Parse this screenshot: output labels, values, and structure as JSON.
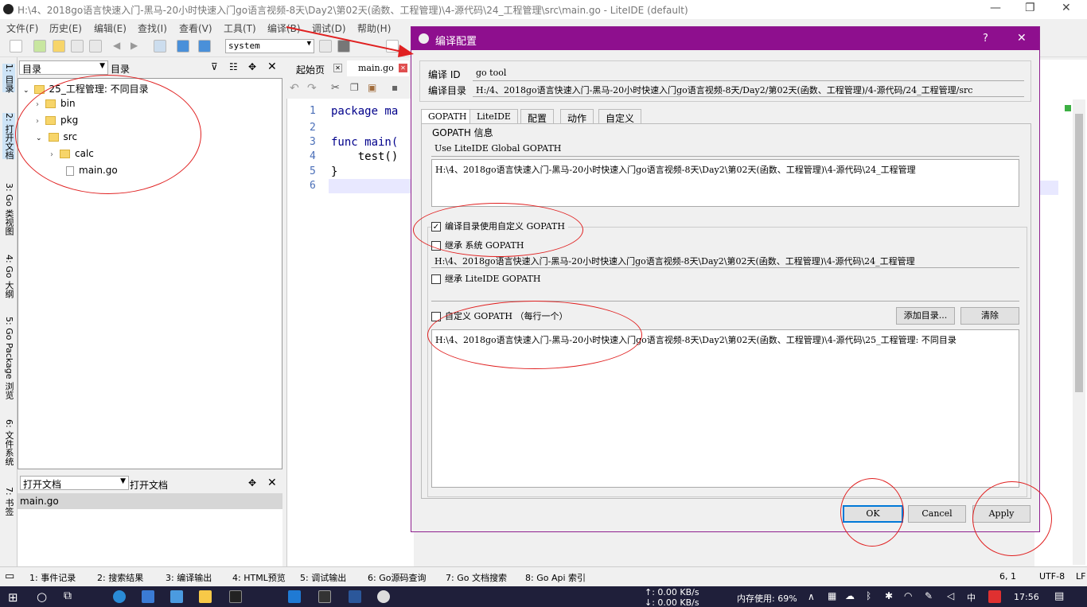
{
  "window": {
    "title": "H:\\4、2018go语言快速入门-黑马-20小时快速入门go语言视频-8天\\Day2\\第02天(函数、工程管理)\\4-源代码\\24_工程管理\\src\\main.go - LiteIDE (default)",
    "minimize": "—",
    "restore": "❐",
    "close": "✕"
  },
  "menu": [
    "文件(F)",
    "历史(E)",
    "编辑(E)",
    "查找(I)",
    "查看(V)",
    "工具(T)",
    "编译(B)",
    "调试(D)",
    "帮助(H)"
  ],
  "toolbar": {
    "env_select": "system"
  },
  "sidetabs": [
    "1: 目录",
    "2: 打开文档",
    "3: Go 类视图",
    "4: Go 大纲",
    "5: Go Package 浏览",
    "6: 文件系统",
    "7: 书签"
  ],
  "dirpanel": {
    "combo": "目录",
    "label": "目录",
    "tree": [
      {
        "label": "25_工程管理: 不同目录",
        "type": "folder"
      },
      {
        "label": "bin",
        "type": "folder"
      },
      {
        "label": "pkg",
        "type": "folder"
      },
      {
        "label": "src",
        "type": "folder"
      },
      {
        "label": "calc",
        "type": "folder"
      },
      {
        "label": "main.go",
        "type": "file"
      }
    ]
  },
  "openpanel": {
    "combo": "打开文档",
    "label": "打开文档",
    "item": "main.go"
  },
  "editor": {
    "tabs": [
      "起始页",
      "main.go"
    ],
    "lines": [
      "1",
      "2",
      "3",
      "4",
      "5",
      "6"
    ],
    "code": [
      "package ma",
      "",
      "func main(",
      "    test()",
      "}",
      ""
    ]
  },
  "statusbar": {
    "tabs": [
      "1: 事件记录",
      "2: 搜索结果",
      "3: 编译输出",
      "4: HTML预览",
      "5: 调试输出",
      "6: Go源码查询",
      "7: Go 文档搜索",
      "8: Go Api 索引"
    ],
    "position": "6,  1",
    "encoding": "UTF-8",
    "eol": "LF"
  },
  "taskbar": {
    "net_up": "↑: 0.00 KB/s",
    "net_down": "↓: 0.00 KB/s",
    "memory": "内存使用: 69%",
    "ime": "中",
    "time": "17:56"
  },
  "dialog": {
    "title": "编译配置",
    "help": "?",
    "close": "✕",
    "id_label": "编译 ID",
    "id_value": "go tool",
    "dir_label": "编译目录",
    "dir_value": "H:/4、2018go语言快速入门-黑马-20小时快速入门go语言视频-8天/Day2/第02天(函数、工程管理)/4-源代码/24_工程管理/src",
    "tabs": [
      "GOPATH",
      "LiteIDE",
      "配置",
      "动作",
      "自定义"
    ],
    "gopath_info_label": "GOPATH 信息",
    "gopath_info_header": "Use LiteIDE Global GOPATH",
    "gopath_info_value": "H:\\4、2018go语言快速入门-黑马-20小时快速入门go语言视频-8天\\Day2\\第02天(函数、工程管理)\\4-源代码\\24_工程管理",
    "use_custom_label": "编译目录使用自定义 GOPATH",
    "use_custom_checked": true,
    "inherit_system_label": "继承 系统 GOPATH",
    "inherit_system_checked": false,
    "inherit_system_value": "H:\\4、2018go语言快速入门-黑马-20小时快速入门go语言视频-8天\\Day2\\第02天(函数、工程管理)\\4-源代码\\24_工程管理",
    "inherit_liteide_label": "继承 LiteIDE GOPATH",
    "inherit_liteide_checked": false,
    "custom_label": "自定义 GOPATH （每行一个）",
    "custom_checked": false,
    "add_dir": "添加目录...",
    "clear": "清除",
    "custom_value": "H:\\4、2018go语言快速入门-黑马-20小时快速入门go语言视频-8天\\Day2\\第02天(函数、工程管理)\\4-源代码\\25_工程管理: 不同目录",
    "ok": "OK",
    "cancel": "Cancel",
    "apply": "Apply"
  },
  "colors": {
    "dialog_title": "#8e0f8e",
    "annotation": "#e02020"
  }
}
